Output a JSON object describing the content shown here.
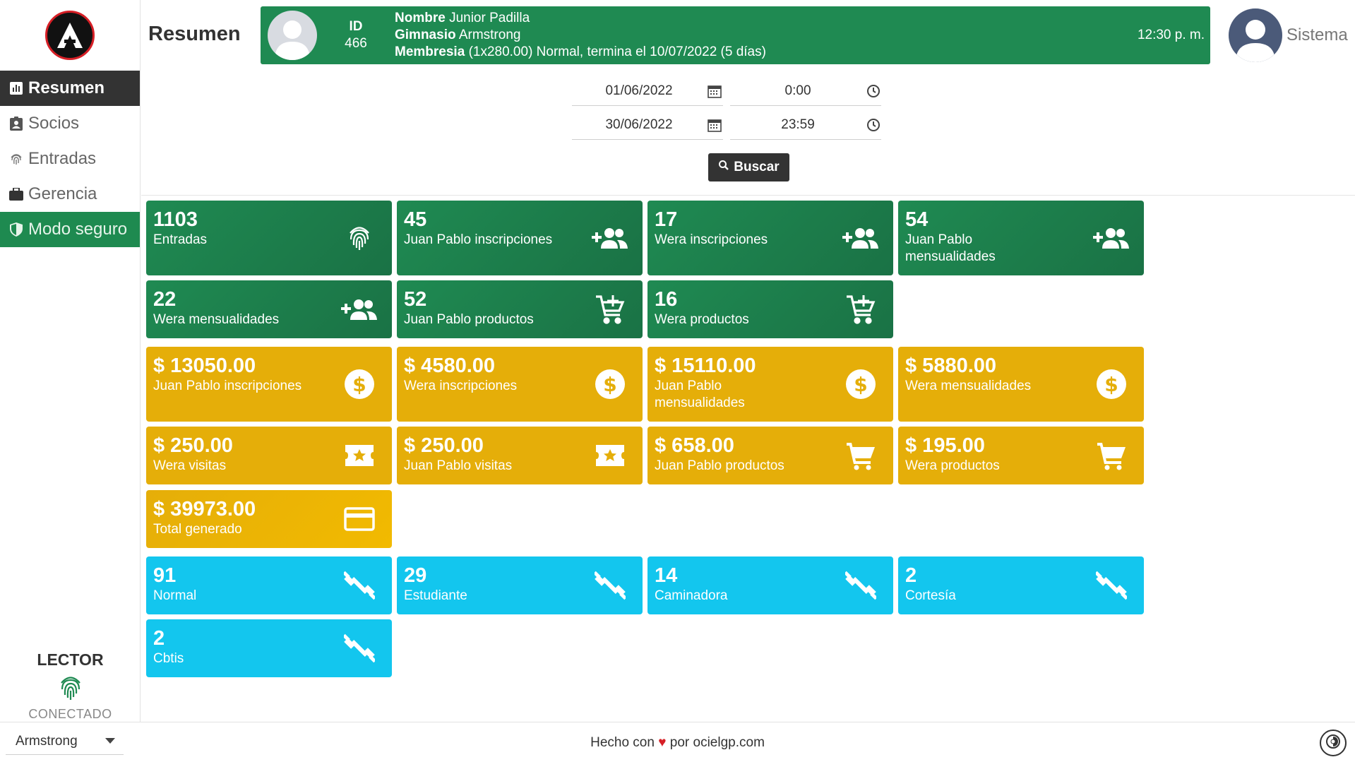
{
  "sidebar": {
    "items": [
      {
        "label": "Resumen",
        "icon": "chart-icon"
      },
      {
        "label": "Socios",
        "icon": "badge-icon"
      },
      {
        "label": "Entradas",
        "icon": "fingerprint-icon"
      },
      {
        "label": "Gerencia",
        "icon": "briefcase-icon"
      },
      {
        "label": "Modo seguro",
        "icon": "shield-icon"
      }
    ],
    "reader_title": "LECTOR",
    "reader_status": "CONECTADO"
  },
  "header": {
    "title": "Resumen",
    "member": {
      "id_label": "ID",
      "id_value": "466",
      "name_label": "Nombre",
      "name_value": "Junior Padilla",
      "gym_label": "Gimnasio",
      "gym_value": "Armstrong",
      "membership_label": "Membresia",
      "membership_value": "(1x280.00) Normal, termina el 10/07/2022 (5 días)",
      "time": "12:30 p. m."
    },
    "user_name": "Sistema"
  },
  "filters": {
    "start_date": "01/06/2022",
    "start_time": "0:00",
    "end_date": "30/06/2022",
    "end_time": "23:59",
    "search_label": "Buscar"
  },
  "cards": {
    "entradas": {
      "value": "1103",
      "label": "Entradas"
    },
    "jp_inscripciones": {
      "value": "45",
      "label": "Juan Pablo inscripciones"
    },
    "wera_inscripciones": {
      "value": "17",
      "label": "Wera inscripciones"
    },
    "jp_mensualidades": {
      "value": "54",
      "label": "Juan Pablo mensualidades"
    },
    "wera_mensualidades": {
      "value": "22",
      "label": "Wera mensualidades"
    },
    "jp_productos": {
      "value": "52",
      "label": "Juan Pablo productos"
    },
    "wera_productos": {
      "value": "16",
      "label": "Wera productos"
    },
    "jp_inscripciones_money": {
      "value": "$ 13050.00",
      "label": "Juan Pablo inscripciones"
    },
    "wera_inscripciones_money": {
      "value": "$ 4580.00",
      "label": "Wera inscripciones"
    },
    "jp_mensualidades_money": {
      "value": "$ 15110.00",
      "label": "Juan Pablo mensualidades"
    },
    "wera_mensualidades_money": {
      "value": "$ 5880.00",
      "label": "Wera mensualidades"
    },
    "wera_visitas_money": {
      "value": "$ 250.00",
      "label": "Wera visitas"
    },
    "jp_visitas_money": {
      "value": "$ 250.00",
      "label": "Juan Pablo visitas"
    },
    "jp_productos_money": {
      "value": "$ 658.00",
      "label": "Juan Pablo productos"
    },
    "wera_productos_money": {
      "value": "$ 195.00",
      "label": "Wera productos"
    },
    "total": {
      "value": "$ 39973.00",
      "label": "Total generado"
    },
    "normal": {
      "value": "91",
      "label": "Normal"
    },
    "estudiante": {
      "value": "29",
      "label": "Estudiante"
    },
    "caminadora": {
      "value": "14",
      "label": "Caminadora"
    },
    "cortesia": {
      "value": "2",
      "label": "Cortesía"
    },
    "cbtis": {
      "value": "2",
      "label": "Cbtis"
    }
  },
  "footer": {
    "gym": "Armstrong",
    "credits_prefix": "Hecho con",
    "heart": "♥",
    "credits_suffix": "por ocielgp.com"
  },
  "colors": {
    "green": "#1f8a52",
    "yellow": "#e5ae09",
    "cyan": "#13c6ee",
    "dark": "#333333",
    "brand_red": "#d61f26"
  }
}
